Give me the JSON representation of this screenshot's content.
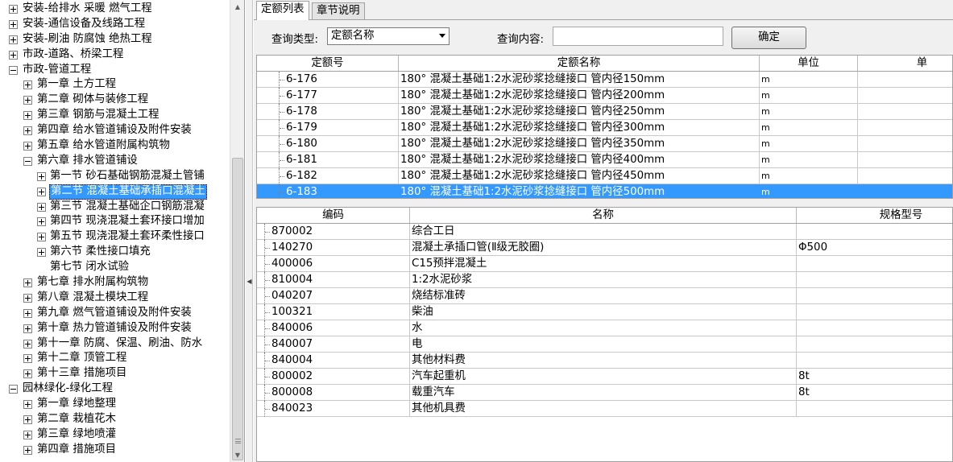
{
  "tree": {
    "items": [
      {
        "label": "安装-给排水 采暖 燃气工程",
        "level": 0,
        "toggle": "plus"
      },
      {
        "label": "安装-通信设备及线路工程",
        "level": 0,
        "toggle": "plus"
      },
      {
        "label": "安装-刷油 防腐蚀 绝热工程",
        "level": 0,
        "toggle": "plus"
      },
      {
        "label": "市政-道路、桥梁工程",
        "level": 0,
        "toggle": "plus"
      },
      {
        "label": "市政-管道工程",
        "level": 0,
        "toggle": "minus"
      },
      {
        "label": "第一章 土方工程",
        "level": 1,
        "toggle": "plus"
      },
      {
        "label": "第二章 砌体与装修工程",
        "level": 1,
        "toggle": "plus"
      },
      {
        "label": "第三章 钢筋与混凝土工程",
        "level": 1,
        "toggle": "plus"
      },
      {
        "label": "第四章 给水管道铺设及附件安装",
        "level": 1,
        "toggle": "plus"
      },
      {
        "label": "第五章 给水管道附属构筑物",
        "level": 1,
        "toggle": "plus"
      },
      {
        "label": "第六章 排水管道铺设",
        "level": 1,
        "toggle": "minus"
      },
      {
        "label": "第一节 砂石基础钢筋混凝土管铺",
        "level": 2,
        "toggle": "plus"
      },
      {
        "label": "第二节 混凝土基础承插口混凝土",
        "level": 2,
        "toggle": "plus",
        "selected": true
      },
      {
        "label": "第三节 混凝土基础企口钢筋混凝",
        "level": 2,
        "toggle": "plus"
      },
      {
        "label": "第四节 现浇混凝土套环接口增加",
        "level": 2,
        "toggle": "plus"
      },
      {
        "label": "第五节 现浇混凝土套环柔性接口",
        "level": 2,
        "toggle": "plus"
      },
      {
        "label": "第六节 柔性接口填充",
        "level": 2,
        "toggle": "plus"
      },
      {
        "label": "第七节 闭水试验",
        "level": 2,
        "toggle": "none"
      },
      {
        "label": "第七章 排水附属构筑物",
        "level": 1,
        "toggle": "plus"
      },
      {
        "label": "第八章 混凝土模块工程",
        "level": 1,
        "toggle": "plus"
      },
      {
        "label": "第九章 燃气管道铺设及附件安装",
        "level": 1,
        "toggle": "plus"
      },
      {
        "label": "第十章 热力管道铺设及附件安装",
        "level": 1,
        "toggle": "plus"
      },
      {
        "label": "第十一章 防腐、保温、刷油、防水",
        "level": 1,
        "toggle": "plus"
      },
      {
        "label": "第十二章 顶管工程",
        "level": 1,
        "toggle": "plus"
      },
      {
        "label": "第十三章 措施项目",
        "level": 1,
        "toggle": "plus"
      },
      {
        "label": "园林绿化-绿化工程",
        "level": 0,
        "toggle": "minus"
      },
      {
        "label": "第一章 绿地整理",
        "level": 1,
        "toggle": "plus"
      },
      {
        "label": "第二章 栽植花木",
        "level": 1,
        "toggle": "plus"
      },
      {
        "label": "第三章 绿地喷灌",
        "level": 1,
        "toggle": "plus"
      },
      {
        "label": "第四章 措施项目",
        "level": 1,
        "toggle": "plus"
      }
    ]
  },
  "tabs": [
    {
      "label": "定额列表",
      "active": true
    },
    {
      "label": "章节说明",
      "active": false
    }
  ],
  "query": {
    "type_label": "查询类型:",
    "type_value": "定额名称",
    "content_label": "查询内容:",
    "content_value": "",
    "confirm_label": "确定"
  },
  "quota_grid": {
    "columns": [
      "定额号",
      "定额名称",
      "单位",
      "单"
    ],
    "rows": [
      {
        "code": "6-176",
        "name": "180° 混凝土基础1:2水泥砂浆捻缝接口 管内径150mm",
        "unit": "m"
      },
      {
        "code": "6-177",
        "name": "180° 混凝土基础1:2水泥砂浆捻缝接口 管内径200mm",
        "unit": "m"
      },
      {
        "code": "6-178",
        "name": "180° 混凝土基础1:2水泥砂浆捻缝接口 管内径250mm",
        "unit": "m"
      },
      {
        "code": "6-179",
        "name": "180° 混凝土基础1:2水泥砂浆捻缝接口 管内径300mm",
        "unit": "m"
      },
      {
        "code": "6-180",
        "name": "180° 混凝土基础1:2水泥砂浆捻缝接口 管内径350mm",
        "unit": "m"
      },
      {
        "code": "6-181",
        "name": "180° 混凝土基础1:2水泥砂浆捻缝接口 管内径400mm",
        "unit": "m"
      },
      {
        "code": "6-182",
        "name": "180° 混凝土基础1:2水泥砂浆捻缝接口 管内径450mm",
        "unit": "m"
      },
      {
        "code": "6-183",
        "name": "180° 混凝土基础1:2水泥砂浆捻缝接口 管内径500mm",
        "unit": "m",
        "selected": true
      }
    ]
  },
  "material_grid": {
    "columns": [
      "编码",
      "名称",
      "规格型号"
    ],
    "rows": [
      {
        "code": "870002",
        "name": "综合工日",
        "spec": ""
      },
      {
        "code": "140270",
        "name": "混凝土承插口管(Ⅱ级无胶圈)",
        "spec": "Φ500"
      },
      {
        "code": "400006",
        "name": "C15预拌混凝土",
        "spec": ""
      },
      {
        "code": "810004",
        "name": "1:2水泥砂浆",
        "spec": ""
      },
      {
        "code": "040207",
        "name": "烧结标准砖",
        "spec": ""
      },
      {
        "code": "100321",
        "name": "柴油",
        "spec": ""
      },
      {
        "code": "840006",
        "name": "水",
        "spec": ""
      },
      {
        "code": "840007",
        "name": "电",
        "spec": ""
      },
      {
        "code": "840004",
        "name": "其他材料费",
        "spec": ""
      },
      {
        "code": "800002",
        "name": "汽车起重机",
        "spec": "8t"
      },
      {
        "code": "800008",
        "name": "载重汽车",
        "spec": "8t"
      },
      {
        "code": "840023",
        "name": "其他机具费",
        "spec": ""
      }
    ]
  }
}
